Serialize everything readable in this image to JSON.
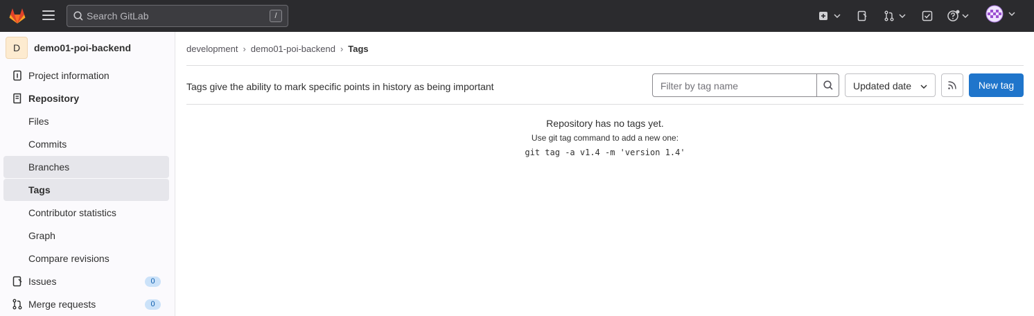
{
  "topbar": {
    "search_placeholder": "Search GitLab",
    "search_shortcut": "/",
    "icons": [
      "gitlab-logo",
      "menu-icon",
      "plus-square-icon",
      "issues-icon",
      "merge-request-icon",
      "todo-icon",
      "help-icon",
      "user-avatar"
    ]
  },
  "sidebar": {
    "project_initial": "D",
    "project_name": "demo01-poi-backend",
    "items": [
      {
        "label": "Project information",
        "icon": "info-icon"
      },
      {
        "label": "Repository",
        "icon": "repository-icon"
      },
      {
        "label": "Files"
      },
      {
        "label": "Commits"
      },
      {
        "label": "Branches"
      },
      {
        "label": "Tags"
      },
      {
        "label": "Contributor statistics"
      },
      {
        "label": "Graph"
      },
      {
        "label": "Compare revisions"
      },
      {
        "label": "Issues",
        "icon": "issues-icon",
        "count": "0"
      },
      {
        "label": "Merge requests",
        "icon": "merge-request-icon",
        "count": "0"
      }
    ]
  },
  "breadcrumb": {
    "items": [
      "development",
      "demo01-poi-backend",
      "Tags"
    ]
  },
  "toolbar": {
    "description": "Tags give the ability to mark specific points in history as being important",
    "filter_placeholder": "Filter by tag name",
    "sort_label": "Updated date",
    "new_tag_label": "New tag"
  },
  "empty_state": {
    "title": "Repository has no tags yet.",
    "subtitle": "Use git tag command to add a new one:",
    "command": "git tag -a v1.4 -m 'version 1.4'"
  },
  "colors": {
    "topbar_bg": "#2b2b2e",
    "primary_button": "#1f75cb",
    "badge_bg": "#cbe2f9",
    "active_nav_bg": "#e6e6eb"
  }
}
